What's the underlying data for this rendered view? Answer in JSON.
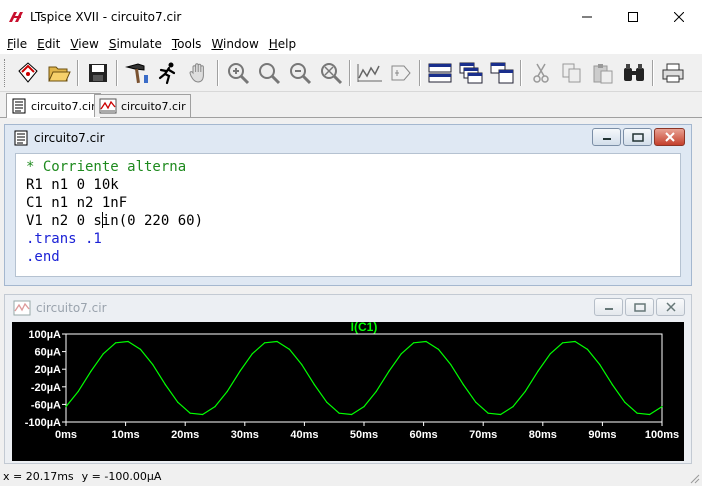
{
  "window": {
    "title": "LTspice XVII - circuito7.cir",
    "minimize_icon": "minimize-icon",
    "maximize_icon": "maximize-icon",
    "close_icon": "close-icon"
  },
  "menu": [
    {
      "ul": "F",
      "rest": "ile"
    },
    {
      "ul": "E",
      "rest": "dit"
    },
    {
      "ul": "V",
      "rest": "iew"
    },
    {
      "ul": "S",
      "rest": "imulate"
    },
    {
      "ul": "T",
      "rest": "ools"
    },
    {
      "ul": "W",
      "rest": "indow"
    },
    {
      "ul": "H",
      "rest": "elp"
    }
  ],
  "toolbar": {
    "icons": [
      "open-schematic-icon",
      "open-folder-icon",
      "save-icon",
      "control-panel-hammer-icon",
      "run-icon",
      "halt-hand-icon",
      "zoom-in-icon",
      "zoom-area-icon",
      "zoom-out-icon",
      "zoom-full-icon",
      "autorange-icon",
      "probe-icon",
      "tile-horizontal-icon",
      "cascade-icon",
      "tile-vertical-icon",
      "cut-icon",
      "copy-icon",
      "paste-icon",
      "find-icon",
      "print-icon"
    ]
  },
  "tabs": [
    {
      "label": "circuito7.cir",
      "icon": "netlist-icon",
      "active": true
    },
    {
      "label": "circuito7.cir",
      "icon": "waveform-icon",
      "active": false
    }
  ],
  "netlist_window": {
    "title": "circuito7.cir",
    "lines": [
      "* Corriente alterna",
      "R1 n1 0 10k",
      "C1 n1 n2 1nF",
      "V1 n2 0 sin(0 220 60)",
      ".trans .1",
      ".end"
    ],
    "caret_line": 3,
    "caret_col": 9
  },
  "plot_window": {
    "title": "circuito7.cir"
  },
  "chart_data": {
    "type": "line",
    "title": "I(C1)",
    "xlabel": "",
    "ylabel": "",
    "xlim": [
      0,
      100
    ],
    "ylim": [
      -100,
      100
    ],
    "x_unit": "ms",
    "y_unit": "µA",
    "x_ticks": [
      "0ms",
      "10ms",
      "20ms",
      "30ms",
      "40ms",
      "50ms",
      "60ms",
      "70ms",
      "80ms",
      "90ms",
      "100ms"
    ],
    "y_ticks": [
      "100µA",
      "60µA",
      "20µA",
      "-20µA",
      "-60µA",
      "-100µA"
    ],
    "y_tick_values": [
      100,
      60,
      20,
      -20,
      -60,
      -100
    ],
    "x_tick_values": [
      0,
      10,
      20,
      30,
      40,
      50,
      60,
      70,
      80,
      90,
      100
    ],
    "series": [
      {
        "name": "I(C1)",
        "color": "#00ff00",
        "description_points": "sinusoid 60Hz amplitude ~83µA",
        "x": [
          0,
          2.08,
          4.17,
          6.25,
          8.33,
          10.42,
          12.5,
          14.58,
          16.67,
          18.75,
          20.83,
          22.92,
          25,
          27.08,
          29.17,
          31.25,
          33.33,
          35.42,
          37.5,
          39.58,
          41.67,
          43.75,
          45.83,
          47.92,
          50,
          52.08,
          54.17,
          56.25,
          58.33,
          60.42,
          62.5,
          64.58,
          66.67,
          68.75,
          70.83,
          72.92,
          75,
          77.08,
          79.17,
          81.25,
          83.33,
          85.42,
          87.5,
          89.58,
          91.67,
          93.75,
          95.83,
          97.92,
          100
        ],
        "y": [
          -65,
          -30,
          15,
          55,
          80,
          83,
          65,
          30,
          -15,
          -55,
          -80,
          -83,
          -65,
          -30,
          15,
          55,
          80,
          83,
          65,
          30,
          -15,
          -55,
          -80,
          -83,
          -65,
          -30,
          15,
          55,
          80,
          83,
          65,
          30,
          -15,
          -55,
          -80,
          -83,
          -65,
          -30,
          15,
          55,
          80,
          83,
          65,
          30,
          -15,
          -55,
          -80,
          -83,
          -65
        ]
      }
    ],
    "grid": false,
    "background": "#000000",
    "axis_color": "#ffffff"
  },
  "status": {
    "x_readout": "x = 20.17ms",
    "y_readout": "y = -100.00µA"
  }
}
